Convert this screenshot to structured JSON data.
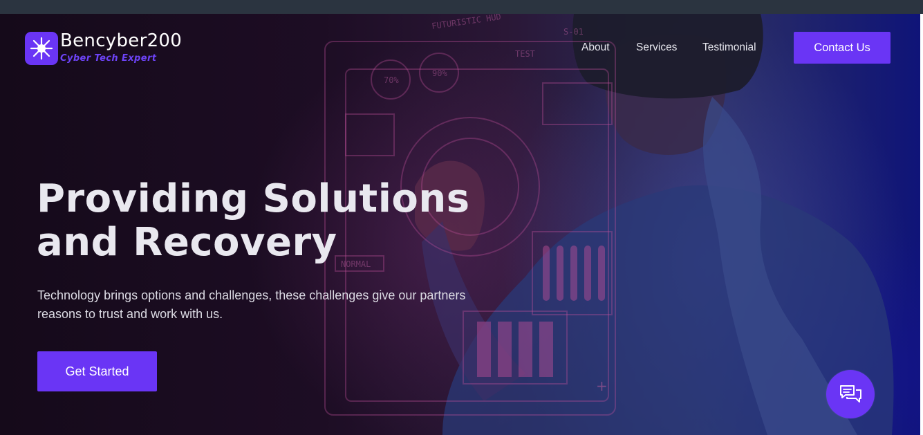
{
  "brand": {
    "name": "Bencyber200",
    "tagline": "Cyber Tech Expert",
    "icon": "starburst-icon"
  },
  "nav": {
    "items": [
      {
        "label": "About"
      },
      {
        "label": "Services"
      },
      {
        "label": "Testimonial"
      }
    ],
    "contact_label": "Contact Us"
  },
  "hero": {
    "headline_line1": "Providing Solutions",
    "headline_line2": "and Recovery",
    "subtext": "Technology brings options and challenges, these challenges give our partners reasons to trust and work with us.",
    "cta_label": "Get Started",
    "hud_labels": [
      "FUTURISTIC HUD",
      "TEST",
      "70%",
      "90%",
      "S-01",
      "NORMAL"
    ]
  },
  "chat": {
    "icon": "chat-bubbles-icon"
  },
  "colors": {
    "accent": "#6a35f5",
    "tagline": "#6d43f7",
    "heading": "#e9e8ef",
    "background_dark": "#150a1a",
    "background_blue": "#0f1478"
  }
}
